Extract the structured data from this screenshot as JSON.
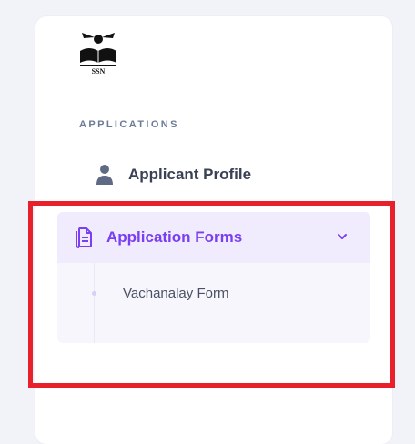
{
  "logo": {
    "text": "SSN"
  },
  "sidebar": {
    "section_heading": "APPLICATIONS",
    "items": [
      {
        "label": "Applicant Profile",
        "icon": "user-icon"
      },
      {
        "label": "Application Forms",
        "icon": "document-icon",
        "expanded": true,
        "children": [
          {
            "label": "Vachanalay Form"
          }
        ]
      }
    ]
  },
  "colors": {
    "accent": "#7a3ff0",
    "annotation": "#e8202b"
  }
}
